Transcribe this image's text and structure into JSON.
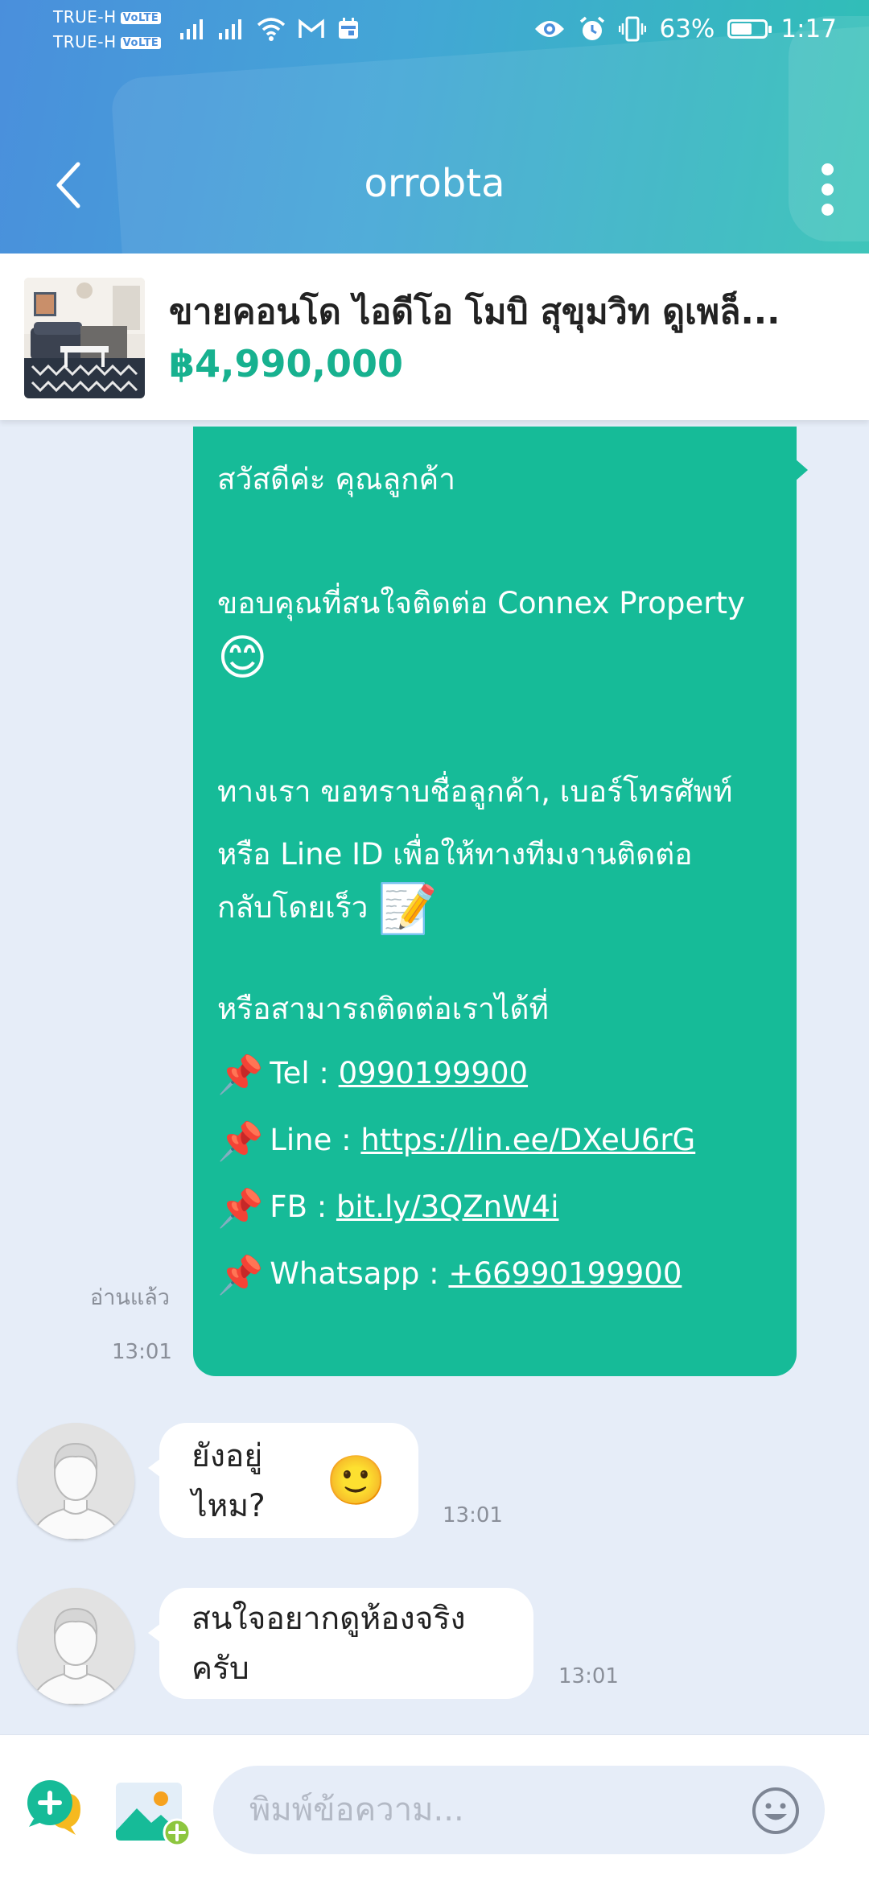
{
  "status_bar": {
    "carrier1": "TRUE-H",
    "carrier2": "TRUE-H",
    "volte": "VoLTE",
    "battery": "63%",
    "battery_level": 0.63,
    "time": "1:17"
  },
  "header": {
    "title": "orrobta"
  },
  "listing": {
    "title": "ขายคอนโด  ไอดีโอ โมบิ สุขุมวิท ดูเพล็...",
    "price": "฿4,990,000"
  },
  "messages": {
    "outgoing": {
      "greeting": "สวัสดีค่ะ คุณลูกค้า",
      "thanks": "ขอบคุณที่สนใจติดต่อ Connex Property",
      "emoji_smile": "😊",
      "request_l1": "ทางเรา ขอทราบชื่อลูกค้า, เบอร์โทรศัพท์",
      "request_l2": "หรือ Line ID เพื่อให้ทางทีมงานติดต่อ",
      "request_l3": "กลับโดยเร็ว",
      "emoji_memo": "📝",
      "contact_intro": "หรือสามารถติดต่อเราได้ที่",
      "pin": "📌",
      "tel_label": "Tel : ",
      "tel_value": "0990199900",
      "line_label": "Line : ",
      "line_value": "https://lin.ee/DXeU6rG",
      "fb_label": "FB : ",
      "fb_value": "bit.ly/3QZnW4i",
      "wa_label": "Whatsapp : ",
      "wa_value": "+66990199900",
      "read_status": "อ่านแล้ว",
      "time": "13:01"
    },
    "incoming": [
      {
        "text": "ยังอยู่ไหม?",
        "emoji": "🙂",
        "time": "13:01"
      },
      {
        "text": "สนใจอยากดูห้องจริงครับ",
        "time": "13:01"
      }
    ]
  },
  "input": {
    "placeholder": "พิมพ์ข้อความ..."
  },
  "colors": {
    "accent": "#16bb98",
    "header_start": "#4a8fdc",
    "header_end": "#2fc0b5",
    "chat_bg": "#e6edf8"
  },
  "icons": [
    "back-arrow-icon",
    "more-vertical-icon",
    "quick-reply-icon",
    "image-picker-icon",
    "emoji-icon",
    "eye-icon",
    "alarm-icon",
    "vibrate-icon",
    "wifi-icon",
    "signal-icon",
    "gmail-icon",
    "calendar-icon"
  ]
}
